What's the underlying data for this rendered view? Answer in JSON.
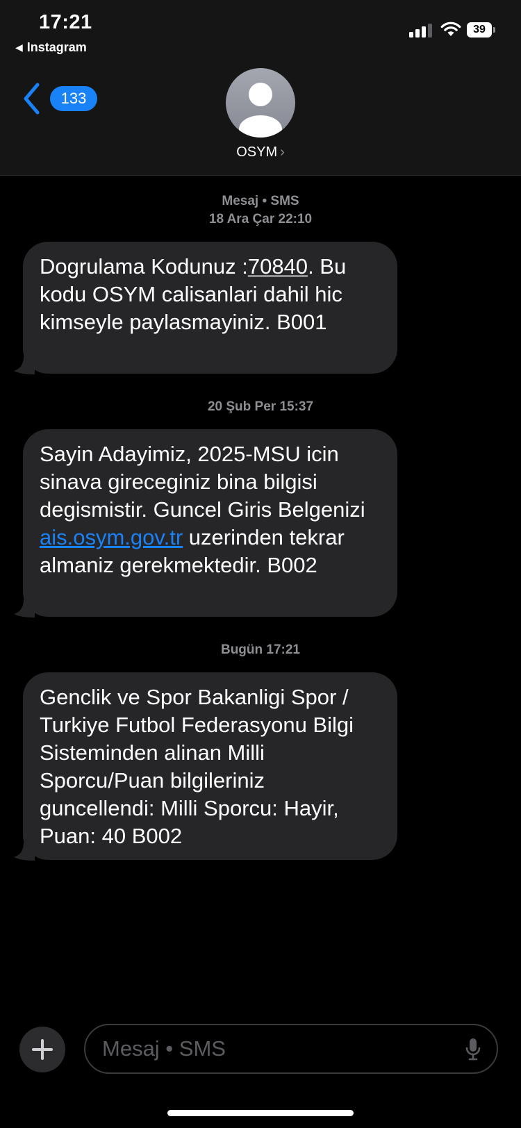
{
  "status": {
    "time": "17:21",
    "back_app": "Instagram",
    "battery": "39"
  },
  "header": {
    "back_count": "133",
    "contact_name": "OSYM"
  },
  "conversation": {
    "channel": "Mesaj • SMS",
    "messages": [
      {
        "timestamp": "18 Ara Çar 22:10",
        "text_before": "Dogrulama Kodunuz :",
        "code": "70840",
        "text_after": ". Bu kodu OSYM calisanlari dahil hic kimseyle paylasmayiniz. B001"
      },
      {
        "timestamp": "20 Şub Per 15:37",
        "text_before": "Sayin Adayimiz, 2025-MSU icin sinava gireceginiz bina bilgisi degismistir. Guncel Giris Belgenizi ",
        "link": "ais.osym.gov.tr",
        "text_after": " uzerinden tekrar almaniz gerekmektedir. B002"
      },
      {
        "timestamp": "Bugün 17:21",
        "text": "Genclik ve Spor Bakanligi Spor / Turkiye Futbol Federasyonu Bilgi Sisteminden alinan Milli Sporcu/Puan bilgileriniz guncellendi: Milli Sporcu: Hayir, Puan: 40 B002"
      }
    ]
  },
  "composer": {
    "placeholder": "Mesaj • SMS"
  },
  "colors": {
    "accent": "#1a82f7",
    "bubble": "#262628",
    "header": "#151516",
    "timestamp": "#8e8e93"
  },
  "icons": [
    "back-chevron-icon",
    "contact-avatar-icon",
    "plus-icon",
    "microphone-icon",
    "wifi-icon",
    "cellular-signal-icon",
    "battery-icon"
  ]
}
